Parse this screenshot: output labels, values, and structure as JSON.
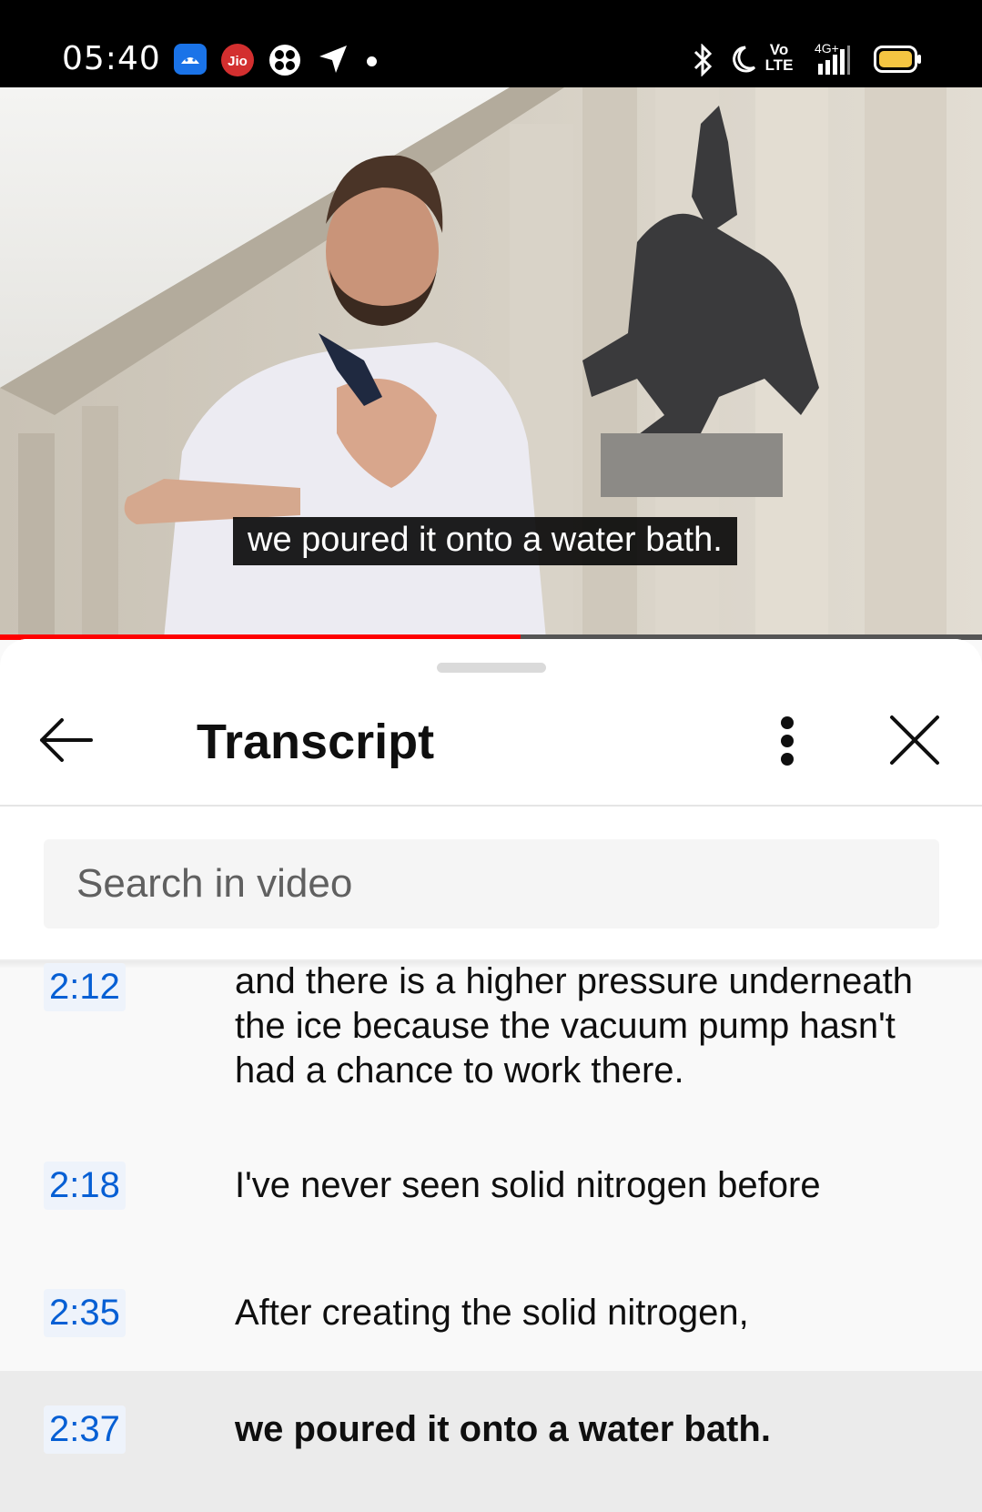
{
  "status_bar": {
    "time": "05:40",
    "left_icons": [
      "android-app-icon",
      "jio-icon",
      "fan-app-icon",
      "location-arrow-icon",
      "notification-dot-icon"
    ],
    "right_icons": [
      "bluetooth-icon",
      "do-not-disturb-moon-icon",
      "volte-icon",
      "signal-4g-icon",
      "battery-icon"
    ],
    "volte_label": "Vo LTE",
    "network_label": "4G+"
  },
  "video": {
    "caption": "we poured it onto a water bath.",
    "progress_fraction": 0.53,
    "progress_color": "#ff0000"
  },
  "sheet": {
    "title": "Transcript",
    "back_icon": "back-arrow-icon",
    "more_icon": "more-vertical-icon",
    "close_icon": "close-icon",
    "search_placeholder": "Search in video"
  },
  "transcript": [
    {
      "time": "2:12",
      "text": "and there is a higher pressure underneath the ice because the vacuum pump hasn't had a chance to work there.",
      "active": false
    },
    {
      "time": "2:18",
      "text": "I've never seen solid nitrogen before",
      "active": false
    },
    {
      "time": "2:35",
      "text": "After creating the solid nitrogen,",
      "active": false
    },
    {
      "time": "2:37",
      "text": "we poured it onto a water bath.",
      "active": true
    }
  ],
  "colors": {
    "timestamp": "#065fd4",
    "active_row": "#ebebeb",
    "sheet_bg": "#f9f9f9"
  }
}
